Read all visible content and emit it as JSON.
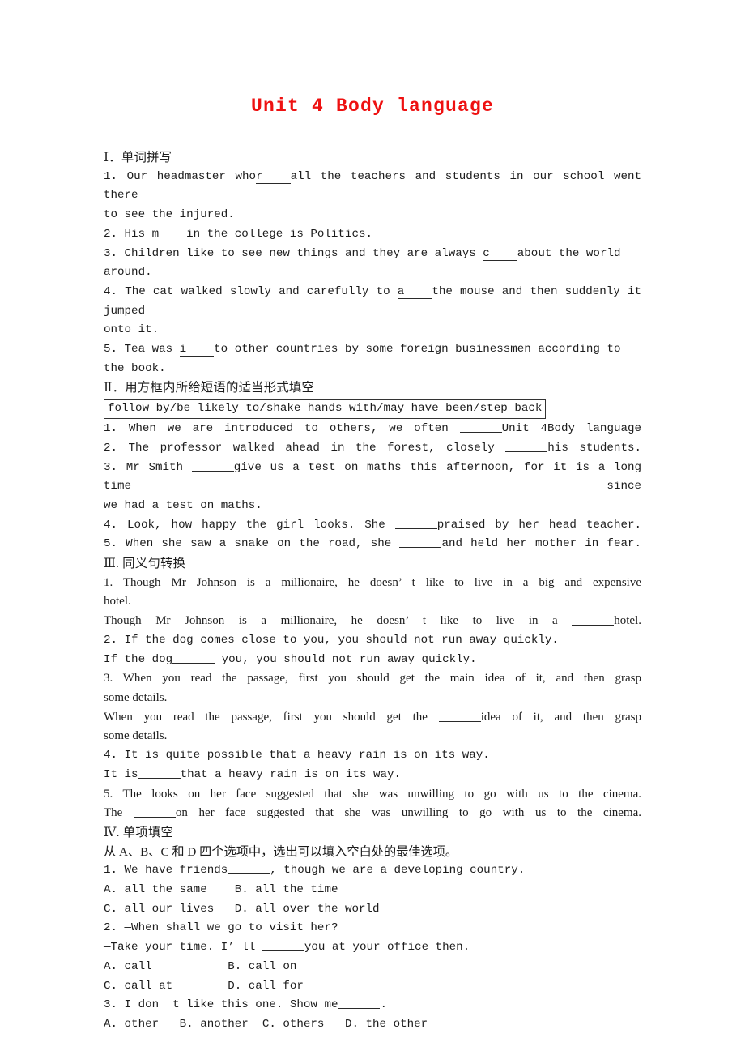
{
  "document": {
    "title": "Unit 4  Body language",
    "title_color": "#ee1111"
  },
  "sections": [
    {
      "heading": "Ⅰ．单词拼写",
      "items": [
        {
          "lines": [
            "1. Our headmaster who",
            "r",
            "all the teachers and students in our school went there",
            "to see the injured."
          ]
        },
        {
          "lines": [
            "2. His ",
            "m",
            "in the college is Politics."
          ]
        },
        {
          "lines": [
            "3. Children like to see new things and they are always ",
            "c",
            "about the world around."
          ]
        },
        {
          "lines": [
            "4. The cat walked slowly and carefully to ",
            "a",
            "the mouse and then suddenly it jumped",
            "onto it."
          ]
        },
        {
          "lines": [
            "5. Tea was ",
            "i",
            "to other countries by some foreign businessmen according to the book."
          ]
        }
      ]
    },
    {
      "heading": "Ⅱ．用方框内所给短语的适当形式填空",
      "phrase_bank": "follow by/be likely to/shake hands with/may have been/step back",
      "items": [
        [
          "1. When we are introduced to others, we often ",
          "Unit 4Body language"
        ],
        [
          "2. The professor walked ahead in the forest, closely ",
          "his students."
        ],
        [
          "3. Mr Smith ",
          "give us a test on maths this afternoon, for it is a long time since",
          "we had a test on maths."
        ],
        [
          "4. Look, how happy the girl looks. She ",
          "praised by her head teacher."
        ],
        [
          "5. When she saw a snake on the road, she ",
          "and held her mother in fear."
        ]
      ]
    },
    {
      "heading": "Ⅲ. 同义句转换",
      "items": [
        {
          "original": [
            "1. Though Mr Johnson is a millionaire, he doesn’ t like to live in a big and expensive",
            "hotel."
          ],
          "rewrite_pre": "Though Mr Johnson is a millionaire, he doesn’ t like to live in a ",
          "rewrite_post": "hotel."
        },
        {
          "original": [
            "2. If the dog comes close to you, you should not run away quickly."
          ],
          "rewrite_pre": "If the dog",
          "rewrite_post": " you, you should not run away quickly."
        },
        {
          "original": [
            "3. When you read the passage, first you should get the main idea of it, and then grasp",
            "some details."
          ],
          "rewrite_pre": "When you read the passage, first you should get the ",
          "rewrite_post": "idea of it, and then grasp",
          "rewrite_tail": "some details."
        },
        {
          "original": [
            "4. It is quite possible that a heavy rain is on its way."
          ],
          "rewrite_pre": "It is",
          "rewrite_post": "that a heavy rain is on its way."
        },
        {
          "original": [
            "5. The looks on her face suggested that she was unwilling to go with us to the cinema."
          ],
          "rewrite_pre": "The ",
          "rewrite_post": "on her face suggested that she was unwilling to go with us to the cinema."
        }
      ]
    },
    {
      "heading": "Ⅳ. 单项填空",
      "instruction": "从 A、B、C 和 D 四个选项中，选出可以填入空白处的最佳选项。",
      "questions": [
        {
          "stem_pre": "1. We have friends",
          "stem_post": ", though we are a developing country.",
          "options_line1": "A. all the same    B. all the time",
          "options_line2": "C. all our lives   D. all over the world"
        },
        {
          "stem_pre": "2. —When shall we go to visit her?",
          "stem_second_pre": "—Take your time. I’ ll ",
          "stem_second_post": "you at your office then.",
          "options_line1": "A. call           B. call on",
          "options_line2": "C. call at        D. call for"
        },
        {
          "stem_pre": "3. I don  t like this one. Show me",
          "stem_post": ".",
          "options_line1": "A. other   B. another  C. others   D. the other"
        }
      ]
    }
  ]
}
